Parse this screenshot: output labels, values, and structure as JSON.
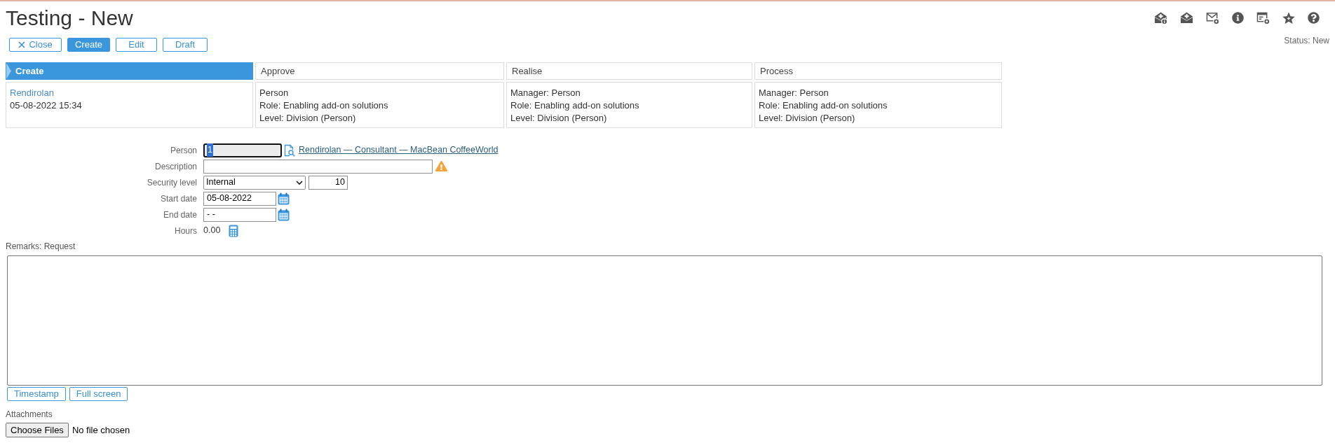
{
  "page": {
    "title": "Testing - New",
    "status": "Status: New"
  },
  "toolbar": [
    {
      "label": "Close",
      "kind": "close",
      "selected": false
    },
    {
      "label": "Create",
      "kind": "plain",
      "selected": true
    },
    {
      "label": "Edit",
      "kind": "plain",
      "selected": false
    },
    {
      "label": "Draft",
      "kind": "plain",
      "selected": false
    }
  ],
  "workflow": [
    {
      "step": "Create",
      "selected": true,
      "lines": [
        {
          "text": "Rendirolan",
          "kind": "link"
        },
        {
          "text": "05-08-2022 15:34",
          "kind": "text"
        }
      ]
    },
    {
      "step": "Approve",
      "selected": false,
      "lines": [
        {
          "text": "Person",
          "kind": "text"
        },
        {
          "text": "Role: Enabling add-on solutions",
          "kind": "text"
        },
        {
          "text": "Level: Division (Person)",
          "kind": "text"
        }
      ]
    },
    {
      "step": "Realise",
      "selected": false,
      "lines": [
        {
          "text": "Manager: Person",
          "kind": "text"
        },
        {
          "text": "Role: Enabling add-on solutions",
          "kind": "text"
        },
        {
          "text": "Level: Division (Person)",
          "kind": "text"
        }
      ]
    },
    {
      "step": "Process",
      "selected": false,
      "lines": [
        {
          "text": "Manager: Person",
          "kind": "text"
        },
        {
          "text": "Role: Enabling add-on solutions",
          "kind": "text"
        },
        {
          "text": "Level: Division (Person)",
          "kind": "text"
        }
      ]
    }
  ],
  "form": {
    "fields": [
      {
        "label": "Person",
        "kind": "lookup",
        "value": "1",
        "focused": true,
        "link": "Rendirolan — Consultant — MacBean CoffeeWorld"
      },
      {
        "label": "Description",
        "kind": "text",
        "warning": true
      },
      {
        "label": "Security level",
        "kind": "select",
        "value": "Internal",
        "number": "10"
      },
      {
        "label": "Start date",
        "kind": "date",
        "value": "05-08-2022"
      },
      {
        "label": "End date",
        "kind": "date",
        "value": "- -"
      },
      {
        "label": "Hours",
        "kind": "readonly",
        "value": "0.00"
      }
    ]
  },
  "remarks": {
    "label": "Remarks: Request",
    "buttons": [
      "Timestamp",
      "Full screen"
    ]
  },
  "attachments": {
    "label": "Attachments",
    "button": "Choose Files",
    "status": "No file chosen"
  }
}
